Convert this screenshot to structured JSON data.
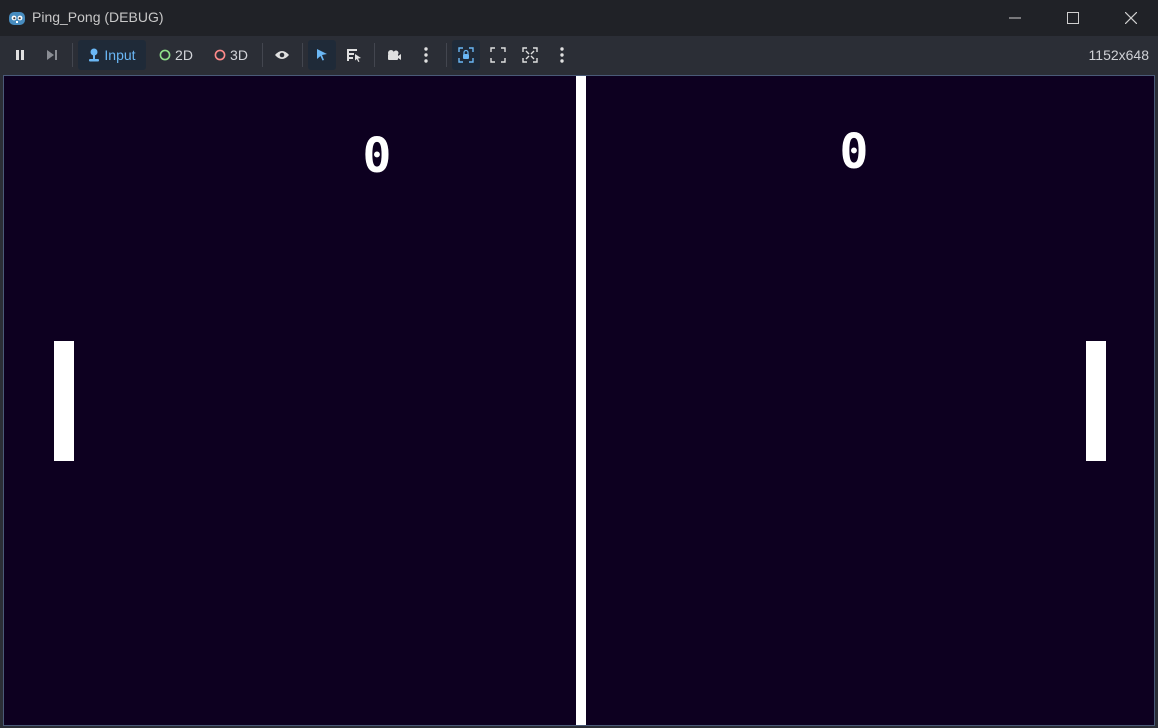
{
  "window": {
    "title": "Ping_Pong (DEBUG)",
    "icons": {
      "app": "godot-icon",
      "minimize": "minimize-icon",
      "maximize": "maximize-icon",
      "close": "close-icon"
    }
  },
  "toolbar": {
    "input_label": "Input",
    "mode_2d_label": "2D",
    "mode_3d_label": "3D",
    "resolution": "1152x648",
    "colors": {
      "accent": "#6ab7f5",
      "green_ring": "#8fe08a",
      "red_ring": "#ff8a8a"
    }
  },
  "game": {
    "background": "#0d0020",
    "score_left": "0",
    "score_right": "0"
  }
}
